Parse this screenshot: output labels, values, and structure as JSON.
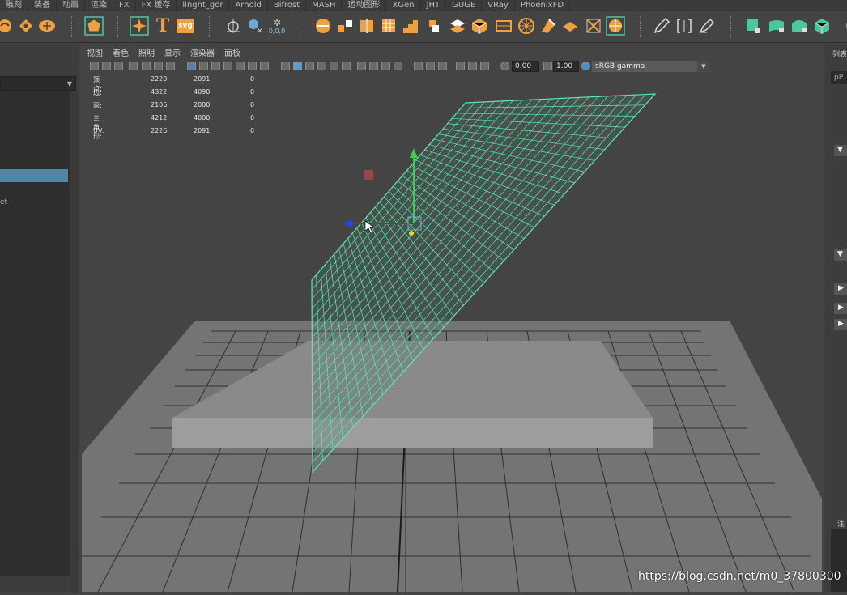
{
  "shelf_tabs": [
    "雕刻",
    "装备",
    "动画",
    "渲染",
    "FX",
    "FX 缓存",
    "linght_gor",
    "Arnold",
    "Bifrost",
    "MASH",
    "运动图形",
    "XGen",
    "JHT",
    "GUGE",
    "VRay",
    "PhoenixFD"
  ],
  "shelf_icons": {
    "text_icon": "T",
    "svg_icon": "svg",
    "coord_readout": "0,0,0"
  },
  "viewport_menu": [
    "视图",
    "着色",
    "照明",
    "显示",
    "渲染器",
    "面板"
  ],
  "viewport_toolbar": {
    "exposure": "0.00",
    "gamma": "1.00",
    "color_space": "sRGB gamma"
  },
  "hud": {
    "rows": [
      {
        "label": "顶点:",
        "v1": "2220",
        "v2": "2091",
        "v3": "0"
      },
      {
        "label": "边:",
        "v1": "4322",
        "v2": "4090",
        "v3": "0"
      },
      {
        "label": "面:",
        "v1": "2106",
        "v2": "2000",
        "v3": "0"
      },
      {
        "label": "三角形:",
        "v1": "4212",
        "v2": "4000",
        "v3": "0"
      },
      {
        "label": "UV:",
        "v1": "2226",
        "v2": "2091",
        "v3": "0"
      }
    ]
  },
  "left_panel": {
    "item_label": "et"
  },
  "right_panel": {
    "header": "列表",
    "field_text": "pP",
    "note_label": "注"
  },
  "watermark": "https://blog.csdn.net/m0_37800300",
  "colors": {
    "accent_orange": "#f0a040",
    "mesh_green": "#5fe6b0",
    "selection_blue": "#5285a6",
    "shelf_green": "#4cc79a"
  }
}
